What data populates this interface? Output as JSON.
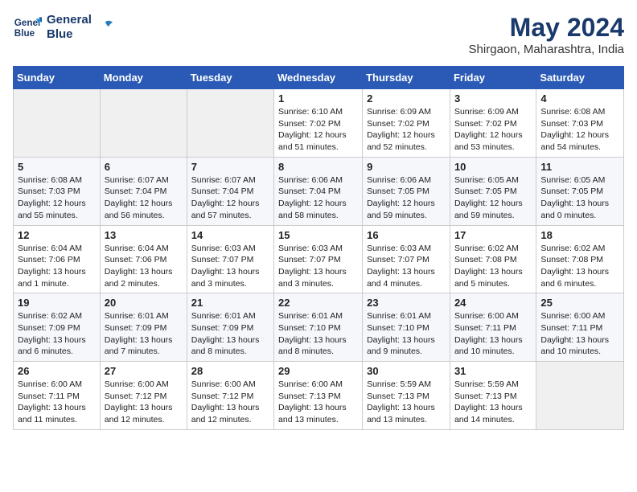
{
  "header": {
    "logo_line1": "General",
    "logo_line2": "Blue",
    "month": "May 2024",
    "location": "Shirgaon, Maharashtra, India"
  },
  "days_of_week": [
    "Sunday",
    "Monday",
    "Tuesday",
    "Wednesday",
    "Thursday",
    "Friday",
    "Saturday"
  ],
  "weeks": [
    [
      {
        "day": "",
        "info": ""
      },
      {
        "day": "",
        "info": ""
      },
      {
        "day": "",
        "info": ""
      },
      {
        "day": "1",
        "info": "Sunrise: 6:10 AM\nSunset: 7:02 PM\nDaylight: 12 hours and 51 minutes."
      },
      {
        "day": "2",
        "info": "Sunrise: 6:09 AM\nSunset: 7:02 PM\nDaylight: 12 hours and 52 minutes."
      },
      {
        "day": "3",
        "info": "Sunrise: 6:09 AM\nSunset: 7:02 PM\nDaylight: 12 hours and 53 minutes."
      },
      {
        "day": "4",
        "info": "Sunrise: 6:08 AM\nSunset: 7:03 PM\nDaylight: 12 hours and 54 minutes."
      }
    ],
    [
      {
        "day": "5",
        "info": "Sunrise: 6:08 AM\nSunset: 7:03 PM\nDaylight: 12 hours and 55 minutes."
      },
      {
        "day": "6",
        "info": "Sunrise: 6:07 AM\nSunset: 7:04 PM\nDaylight: 12 hours and 56 minutes."
      },
      {
        "day": "7",
        "info": "Sunrise: 6:07 AM\nSunset: 7:04 PM\nDaylight: 12 hours and 57 minutes."
      },
      {
        "day": "8",
        "info": "Sunrise: 6:06 AM\nSunset: 7:04 PM\nDaylight: 12 hours and 58 minutes."
      },
      {
        "day": "9",
        "info": "Sunrise: 6:06 AM\nSunset: 7:05 PM\nDaylight: 12 hours and 59 minutes."
      },
      {
        "day": "10",
        "info": "Sunrise: 6:05 AM\nSunset: 7:05 PM\nDaylight: 12 hours and 59 minutes."
      },
      {
        "day": "11",
        "info": "Sunrise: 6:05 AM\nSunset: 7:05 PM\nDaylight: 13 hours and 0 minutes."
      }
    ],
    [
      {
        "day": "12",
        "info": "Sunrise: 6:04 AM\nSunset: 7:06 PM\nDaylight: 13 hours and 1 minute."
      },
      {
        "day": "13",
        "info": "Sunrise: 6:04 AM\nSunset: 7:06 PM\nDaylight: 13 hours and 2 minutes."
      },
      {
        "day": "14",
        "info": "Sunrise: 6:03 AM\nSunset: 7:07 PM\nDaylight: 13 hours and 3 minutes."
      },
      {
        "day": "15",
        "info": "Sunrise: 6:03 AM\nSunset: 7:07 PM\nDaylight: 13 hours and 3 minutes."
      },
      {
        "day": "16",
        "info": "Sunrise: 6:03 AM\nSunset: 7:07 PM\nDaylight: 13 hours and 4 minutes."
      },
      {
        "day": "17",
        "info": "Sunrise: 6:02 AM\nSunset: 7:08 PM\nDaylight: 13 hours and 5 minutes."
      },
      {
        "day": "18",
        "info": "Sunrise: 6:02 AM\nSunset: 7:08 PM\nDaylight: 13 hours and 6 minutes."
      }
    ],
    [
      {
        "day": "19",
        "info": "Sunrise: 6:02 AM\nSunset: 7:09 PM\nDaylight: 13 hours and 6 minutes."
      },
      {
        "day": "20",
        "info": "Sunrise: 6:01 AM\nSunset: 7:09 PM\nDaylight: 13 hours and 7 minutes."
      },
      {
        "day": "21",
        "info": "Sunrise: 6:01 AM\nSunset: 7:09 PM\nDaylight: 13 hours and 8 minutes."
      },
      {
        "day": "22",
        "info": "Sunrise: 6:01 AM\nSunset: 7:10 PM\nDaylight: 13 hours and 8 minutes."
      },
      {
        "day": "23",
        "info": "Sunrise: 6:01 AM\nSunset: 7:10 PM\nDaylight: 13 hours and 9 minutes."
      },
      {
        "day": "24",
        "info": "Sunrise: 6:00 AM\nSunset: 7:11 PM\nDaylight: 13 hours and 10 minutes."
      },
      {
        "day": "25",
        "info": "Sunrise: 6:00 AM\nSunset: 7:11 PM\nDaylight: 13 hours and 10 minutes."
      }
    ],
    [
      {
        "day": "26",
        "info": "Sunrise: 6:00 AM\nSunset: 7:11 PM\nDaylight: 13 hours and 11 minutes."
      },
      {
        "day": "27",
        "info": "Sunrise: 6:00 AM\nSunset: 7:12 PM\nDaylight: 13 hours and 12 minutes."
      },
      {
        "day": "28",
        "info": "Sunrise: 6:00 AM\nSunset: 7:12 PM\nDaylight: 13 hours and 12 minutes."
      },
      {
        "day": "29",
        "info": "Sunrise: 6:00 AM\nSunset: 7:13 PM\nDaylight: 13 hours and 13 minutes."
      },
      {
        "day": "30",
        "info": "Sunrise: 5:59 AM\nSunset: 7:13 PM\nDaylight: 13 hours and 13 minutes."
      },
      {
        "day": "31",
        "info": "Sunrise: 5:59 AM\nSunset: 7:13 PM\nDaylight: 13 hours and 14 minutes."
      },
      {
        "day": "",
        "info": ""
      }
    ]
  ]
}
